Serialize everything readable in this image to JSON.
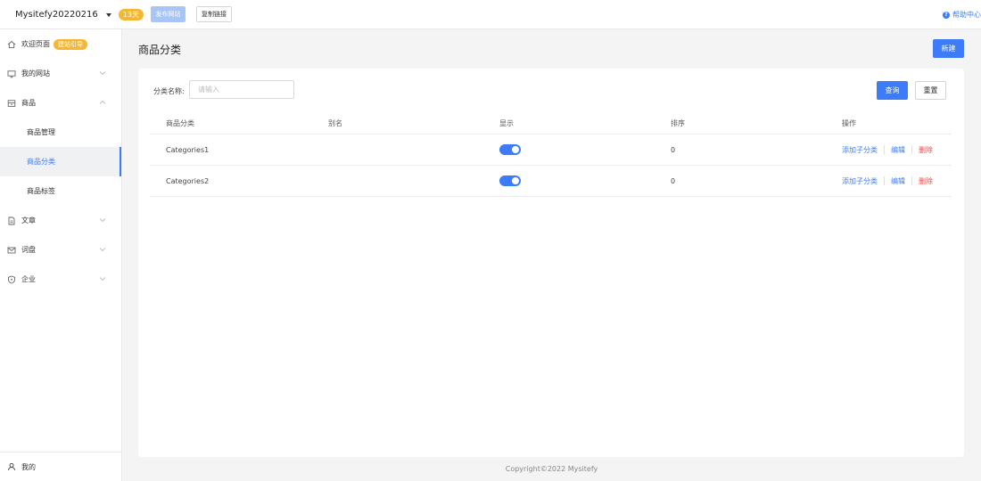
{
  "topbar": {
    "site_name": "Mysitefy20220216",
    "days_badge": "13天",
    "publish_label": "发布网站",
    "copy_label": "复制链接",
    "help_label": "帮助中心"
  },
  "sidebar": {
    "welcome": {
      "label": "欢迎页面",
      "badge": "建站引导"
    },
    "my_site": "我的网站",
    "products": "商品",
    "sub_items": [
      "商品管理",
      "商品分类",
      "商品标签"
    ],
    "active_sub": "商品分类",
    "articles": "文章",
    "survey": "词盘",
    "company": "企业",
    "me": "我的"
  },
  "main": {
    "title": "商品分类",
    "new_label": "新建",
    "filter": {
      "label": "分类名称:",
      "placeholder": "请输入",
      "value": "",
      "query_label": "查询",
      "reset_label": "重置"
    },
    "table": {
      "headers": [
        "商品分类",
        "别名",
        "显示",
        "排序",
        "操作"
      ],
      "rows": [
        {
          "name": "Categories1",
          "alias": "",
          "show": true,
          "sort": "0"
        },
        {
          "name": "Categories2",
          "alias": "",
          "show": true,
          "sort": "0"
        }
      ],
      "actions": {
        "add_sub": "添加子分类",
        "edit": "编辑",
        "delete": "删除"
      }
    }
  },
  "footer": {
    "copyright": "Copyright©2022 Mysitefy"
  },
  "colors": {
    "primary": "#3d7bf7",
    "badge": "#f5b731",
    "danger": "#f04848"
  }
}
